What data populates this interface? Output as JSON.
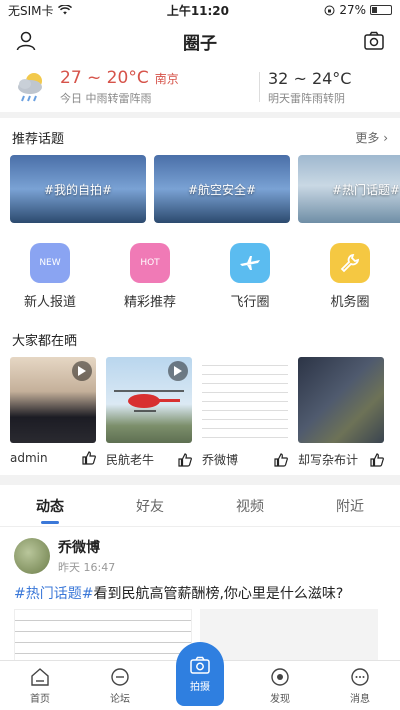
{
  "status_bar": {
    "carrier": "无SIM卡",
    "time": "上午11:20",
    "battery": "27%"
  },
  "nav": {
    "title": "圈子"
  },
  "weather": {
    "today_temp": "27 ~ 20°C",
    "city": "南京",
    "today_desc": "今日 中雨转雷阵雨",
    "tomorrow_temp": "32 ~ 24°C",
    "tomorrow_desc": "明天雷阵雨转阴"
  },
  "topics": {
    "title": "推荐话题",
    "more": "更多 ›",
    "items": [
      {
        "label": "#我的自拍#"
      },
      {
        "label": "#航空安全#"
      },
      {
        "label": "#热门话题#"
      }
    ]
  },
  "quick": [
    {
      "label": "新人报道",
      "icon": "new-icon",
      "color": "#8aa4f2"
    },
    {
      "label": "精彩推荐",
      "icon": "hot-icon",
      "color": "#f07ab6"
    },
    {
      "label": "飞行圈",
      "icon": "plane-icon",
      "color": "#5bbcf0"
    },
    {
      "label": "机务圈",
      "icon": "wrench-icon",
      "color": "#f5c842"
    }
  ],
  "shares": {
    "title": "大家都在晒",
    "items": [
      {
        "user": "admin"
      },
      {
        "user": "民航老牛"
      },
      {
        "user": "乔微博"
      },
      {
        "user": "却写杂布计"
      }
    ]
  },
  "tabs": [
    {
      "label": "动态"
    },
    {
      "label": "好友"
    },
    {
      "label": "视频"
    },
    {
      "label": "附近"
    }
  ],
  "post": {
    "name": "乔微博",
    "time": "昨天 16:47",
    "tag": "#热门话题#",
    "text": "看到民航高管薪酬榜,你心里是什么滋味?"
  },
  "bottom_nav": [
    {
      "label": "首页"
    },
    {
      "label": "论坛"
    },
    {
      "label": "拍摄"
    },
    {
      "label": "发现"
    },
    {
      "label": "消息"
    }
  ]
}
